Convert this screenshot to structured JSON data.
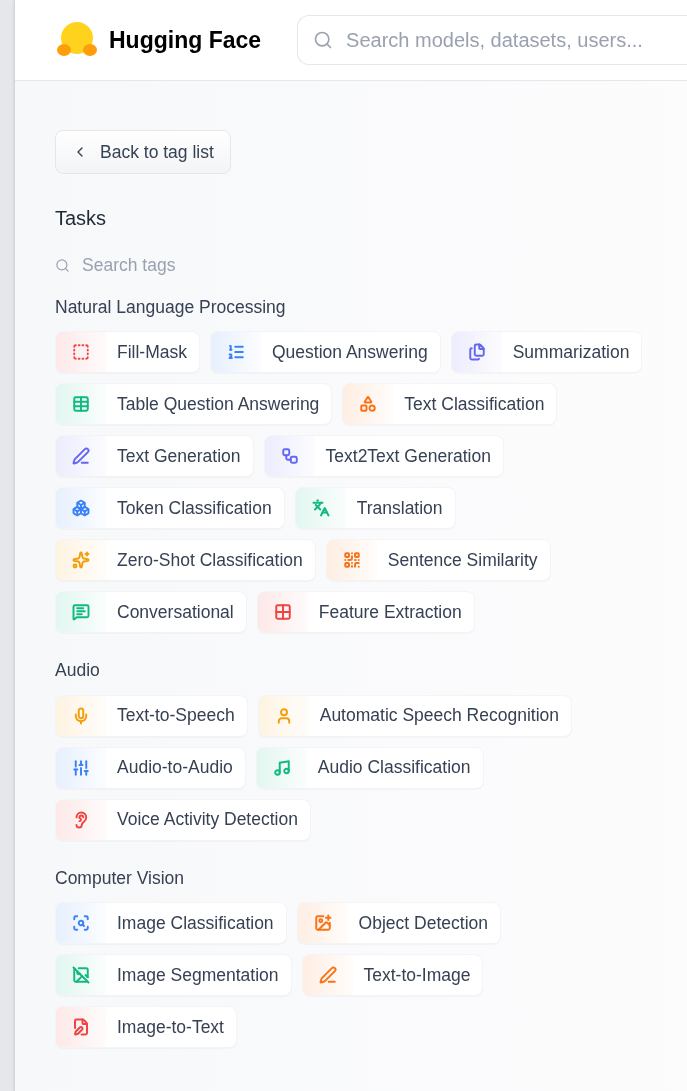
{
  "header": {
    "brand": "Hugging Face",
    "search": {
      "placeholder": "Search models, datasets, users..."
    }
  },
  "back_button": "Back to tag list",
  "heading": "Tasks",
  "tag_search": {
    "placeholder": "Search tags"
  },
  "sections": [
    {
      "title": "Natural Language Processing",
      "tags": [
        {
          "label": "Fill-Mask",
          "color": "#ef4444"
        },
        {
          "label": "Question Answering",
          "color": "#3b82f6"
        },
        {
          "label": "Summarization",
          "color": "#6366f1"
        },
        {
          "label": "Table Question Answering",
          "color": "#10b981"
        },
        {
          "label": "Text Classification",
          "color": "#f97316"
        },
        {
          "label": "Text Generation",
          "color": "#6366f1"
        },
        {
          "label": "Text2Text Generation",
          "color": "#6366f1"
        },
        {
          "label": "Token Classification",
          "color": "#3b82f6"
        },
        {
          "label": "Translation",
          "color": "#10b981"
        },
        {
          "label": "Zero-Shot Classification",
          "color": "#f59e0b"
        },
        {
          "label": "Sentence Similarity",
          "color": "#f97316"
        },
        {
          "label": "Conversational",
          "color": "#10b981"
        },
        {
          "label": "Feature Extraction",
          "color": "#ef4444"
        }
      ]
    },
    {
      "title": "Audio",
      "tags": [
        {
          "label": "Text-to-Speech",
          "color": "#f59e0b"
        },
        {
          "label": "Automatic Speech Recognition",
          "color": "#f59e0b"
        },
        {
          "label": "Audio-to-Audio",
          "color": "#3b82f6"
        },
        {
          "label": "Audio Classification",
          "color": "#10b981"
        },
        {
          "label": "Voice Activity Detection",
          "color": "#ef4444"
        }
      ]
    },
    {
      "title": "Computer Vision",
      "tags": [
        {
          "label": "Image Classification",
          "color": "#3b82f6"
        },
        {
          "label": "Object Detection",
          "color": "#f97316"
        },
        {
          "label": "Image Segmentation",
          "color": "#10b981"
        },
        {
          "label": "Text-to-Image",
          "color": "#f97316"
        },
        {
          "label": "Image-to-Text",
          "color": "#ef4444"
        }
      ]
    }
  ]
}
